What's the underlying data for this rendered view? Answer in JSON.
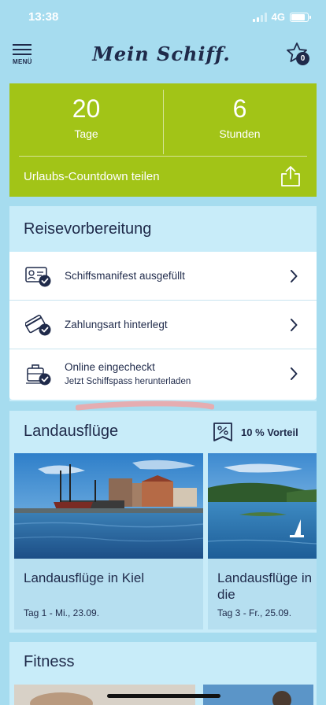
{
  "status_bar": {
    "time": "13:38",
    "network": "4G"
  },
  "header": {
    "menu_label": "MENÜ",
    "logo_text": "Mein Schiff.",
    "favorites_count": "0"
  },
  "countdown": {
    "days_value": "20",
    "days_label": "Tage",
    "hours_value": "6",
    "hours_label": "Stunden",
    "share_label": "Urlaubs-Countdown teilen"
  },
  "preparation": {
    "title": "Reisevorbereitung",
    "items": [
      {
        "label": "Schiffsmanifest ausgefüllt",
        "sublabel": "",
        "icon": "id-card-check-icon"
      },
      {
        "label": "Zahlungsart hinterlegt",
        "sublabel": "",
        "icon": "credit-card-check-icon"
      },
      {
        "label": "Online eingecheckt",
        "sublabel": "Jetzt Schiffspass herunterladen",
        "icon": "luggage-check-icon"
      }
    ]
  },
  "excursions": {
    "title": "Landausflüge",
    "badge": "10 % Vorteil",
    "cards": [
      {
        "title": "Landausflüge in Kiel",
        "date": "Tag 1 - Mi., 23.09."
      },
      {
        "title": "Landausflüge in Fahrt durch die",
        "date": "Tag 3 - Fr., 25.09."
      }
    ]
  },
  "fitness": {
    "title": "Fitness"
  },
  "colors": {
    "accent_green": "#a2c417",
    "navy": "#1f2a4a",
    "background": "#a6dcef",
    "card": "#c8ecf9"
  }
}
